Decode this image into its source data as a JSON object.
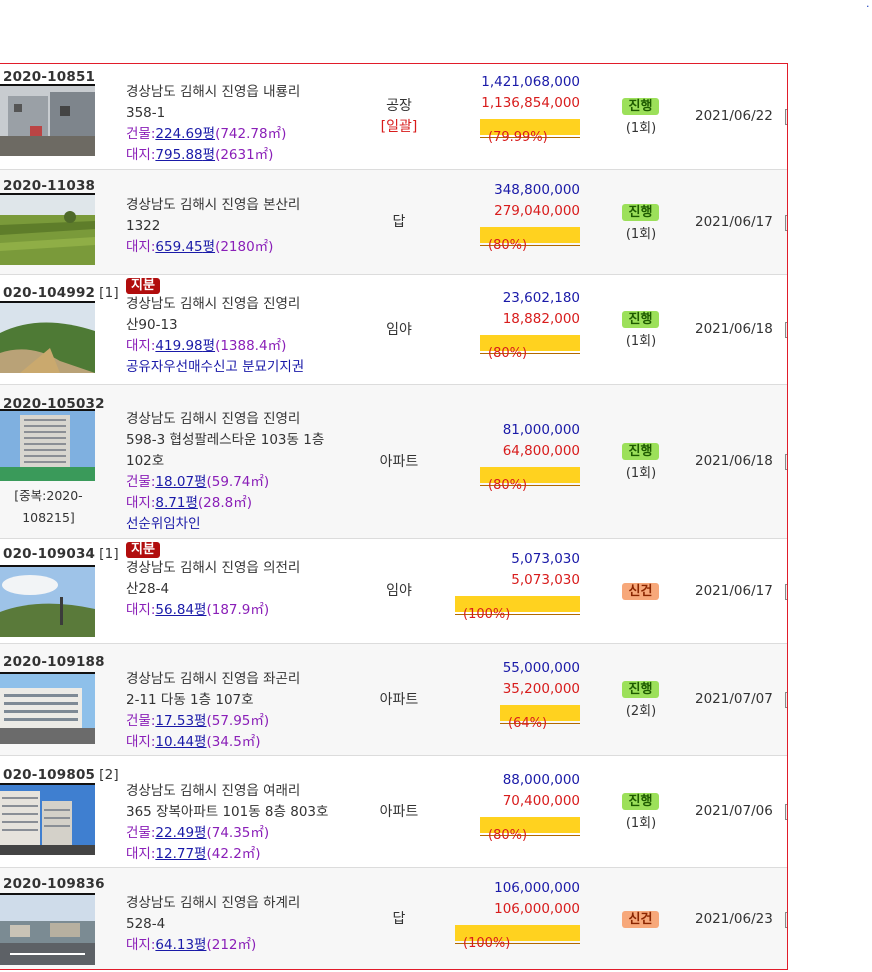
{
  "page": {
    "corner_mark": "·"
  },
  "rows": [
    {
      "case_no": "2020-10851",
      "case_count": "",
      "share_tag": "",
      "address_line1": "경상남도 김해시 진영읍 내룡리",
      "address_line2": "358-1",
      "building_area": {
        "label": "건물:",
        "pyeong": "224.69",
        "unit": "평",
        "m2": "(742.78㎡)"
      },
      "land_area": {
        "label": "대지:",
        "pyeong": "795.88",
        "unit": "평",
        "m2": "(2631㎡)"
      },
      "special_note": "",
      "usage": "공장",
      "usage_sub": "[일괄]",
      "appraisal": "1,421,068,000",
      "min_price": "1,136,854,000",
      "rate": "(79.99%)",
      "rate_percent": 79.99,
      "status": "진행",
      "status_type": "ongoing",
      "round": "(1회)",
      "date": "2021/06/22",
      "dup_note": "",
      "photo": "factory"
    },
    {
      "case_no": "2020-11038",
      "case_count": "",
      "share_tag": "",
      "address_line1": "경상남도 김해시 진영읍 본산리",
      "address_line2": "1322",
      "building_area": null,
      "land_area": {
        "label": "대지:",
        "pyeong": "659.45",
        "unit": "평",
        "m2": "(2180㎡)"
      },
      "special_note": "",
      "usage": "답",
      "usage_sub": "",
      "appraisal": "348,800,000",
      "min_price": "279,040,000",
      "rate": "(80%)",
      "rate_percent": 80,
      "status": "진행",
      "status_type": "ongoing",
      "round": "(1회)",
      "date": "2021/06/17",
      "dup_note": "",
      "photo": "field"
    },
    {
      "case_no": "020-104992",
      "case_count": "[1]",
      "share_tag": "지분",
      "address_line1": "경상남도 김해시 진영읍 진영리",
      "address_line2": "산90-13",
      "building_area": null,
      "land_area": {
        "label": "대지:",
        "pyeong": "419.98",
        "unit": "평",
        "m2": "(1388.4㎡)"
      },
      "special_note": "공유자우선매수신고 분묘기지권",
      "usage": "임야",
      "usage_sub": "",
      "appraisal": "23,602,180",
      "min_price": "18,882,000",
      "rate": "(80%)",
      "rate_percent": 80,
      "status": "진행",
      "status_type": "ongoing",
      "round": "(1회)",
      "date": "2021/06/18",
      "dup_note": "",
      "photo": "hill"
    },
    {
      "case_no": "2020-105032",
      "case_count": "",
      "share_tag": "",
      "address_line1": "경상남도 김해시 진영읍 진영리",
      "address_line2": "598-3 협성팔레스타운 103동 1층",
      "address_line3": "102호",
      "building_area": {
        "label": "건물:",
        "pyeong": "18.07",
        "unit": "평",
        "m2": "(59.74㎡)"
      },
      "land_area": {
        "label": "대지:",
        "pyeong": "8.71",
        "unit": "평",
        "m2": "(28.8㎡)"
      },
      "special_note": "선순위임차인",
      "usage": "아파트",
      "usage_sub": "",
      "appraisal": "81,000,000",
      "min_price": "64,800,000",
      "rate": "(80%)",
      "rate_percent": 80,
      "status": "진행",
      "status_type": "ongoing",
      "round": "(1회)",
      "date": "2021/06/18",
      "dup_note_line1": "[중복:2020-",
      "dup_note_line2": "108215]",
      "photo": "apartment"
    },
    {
      "case_no": "020-109034",
      "case_count": "[1]",
      "share_tag": "지분",
      "address_line1": "경상남도 김해시 진영읍 의전리",
      "address_line2": "산28-4",
      "building_area": null,
      "land_area": {
        "label": "대지:",
        "pyeong": "56.84",
        "unit": "평",
        "m2": "(187.9㎡)"
      },
      "special_note": "",
      "usage": "임야",
      "usage_sub": "",
      "appraisal": "5,073,030",
      "min_price": "5,073,030",
      "rate": "(100%)",
      "rate_percent": 100,
      "status": "신건",
      "status_type": "new",
      "round": "",
      "date": "2021/06/17",
      "dup_note": "",
      "photo": "sky"
    },
    {
      "case_no": "2020-109188",
      "case_count": "",
      "share_tag": "",
      "address_line1": "경상남도 김해시 진영읍 좌곤리",
      "address_line2": "2-11 다동 1층 107호",
      "building_area": {
        "label": "건물:",
        "pyeong": "17.53",
        "unit": "평",
        "m2": "(57.95㎡)"
      },
      "land_area": {
        "label": "대지:",
        "pyeong": "10.44",
        "unit": "평",
        "m2": "(34.5㎡)"
      },
      "special_note": "",
      "usage": "아파트",
      "usage_sub": "",
      "appraisal": "55,000,000",
      "min_price": "35,200,000",
      "rate": "(64%)",
      "rate_percent": 64,
      "status": "진행",
      "status_type": "ongoing",
      "round": "(2회)",
      "date": "2021/07/07",
      "dup_note": "",
      "photo": "lowrise"
    },
    {
      "case_no": "020-109805",
      "case_count": "[2]",
      "share_tag": "",
      "address_line1": "경상남도 김해시 진영읍 여래리",
      "address_line2": "365 장복아파트 101동 8층 803호",
      "building_area": {
        "label": "건물:",
        "pyeong": "22.49",
        "unit": "평",
        "m2": "(74.35㎡)"
      },
      "land_area": {
        "label": "대지:",
        "pyeong": "12.77",
        "unit": "평",
        "m2": "(42.2㎡)"
      },
      "special_note": "",
      "usage": "아파트",
      "usage_sub": "",
      "appraisal": "88,000,000",
      "min_price": "70,400,000",
      "rate": "(80%)",
      "rate_percent": 80,
      "status": "진행",
      "status_type": "ongoing",
      "round": "(1회)",
      "date": "2021/07/06",
      "dup_note": "",
      "photo": "apartment2"
    },
    {
      "case_no": "2020-109836",
      "case_count": "",
      "share_tag": "",
      "address_line1": "경상남도 김해시 진영읍 하계리",
      "address_line2": "528-4",
      "building_area": null,
      "land_area": {
        "label": "대지:",
        "pyeong": "64.13",
        "unit": "평",
        "m2": "(212㎡)"
      },
      "special_note": "",
      "usage": "답",
      "usage_sub": "",
      "appraisal": "106,000,000",
      "min_price": "106,000,000",
      "rate": "(100%)",
      "rate_percent": 100,
      "status": "신건",
      "status_type": "new",
      "round": "",
      "date": "2021/06/23",
      "dup_note": "",
      "photo": "street"
    }
  ]
}
